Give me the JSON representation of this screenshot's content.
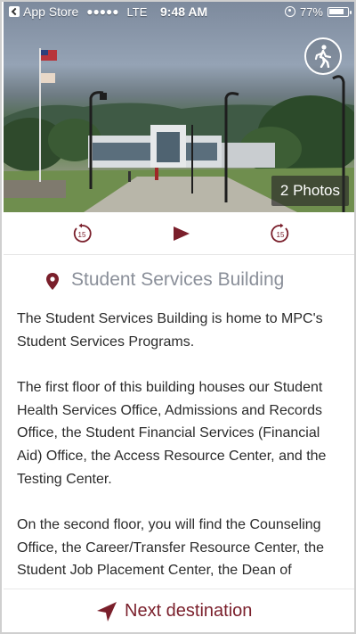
{
  "status_bar": {
    "carrier": "App Store",
    "signal": "●●●●●",
    "network": "LTE",
    "time": "9:48 AM",
    "battery": "77%"
  },
  "hero": {
    "photos_label": "2 Photos"
  },
  "player": {
    "rewind_label": "15",
    "forward_label": "15",
    "accent_color": "#7a1f2b"
  },
  "location": {
    "title": "Student Services Building"
  },
  "description": {
    "paragraphs": [
      "The Student Services Building is home to MPC's Student Services Programs.",
      "The first floor of this building houses our Student Health Services Office, Admissions and Records Office, the Student Financial Services (Financial Aid) Office, the Access Resource Center, and the Testing Center.",
      "On the second floor, you will find the Counseling Office, the Career/Transfer Resource Center, the Student Job Placement Center, the Dean of"
    ]
  },
  "footer": {
    "next_label": "Next destination"
  }
}
